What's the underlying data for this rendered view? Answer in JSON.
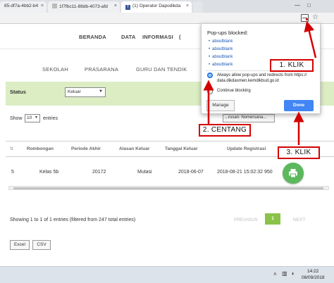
{
  "browser": {
    "tabs": [
      {
        "label": "85-df7a-4bb2-b4"
      },
      {
        "label": "1f7fbc11-88db-4073-afd"
      },
      {
        "label": "(1) Operator Dapodikda"
      }
    ],
    "window_controls": {
      "minimize": "—",
      "maximize": "□"
    },
    "toolbar_icons": [
      "popup-blocked-icon",
      "star-icon"
    ]
  },
  "nav": {
    "items": [
      {
        "label": "BERANDA"
      },
      {
        "label": "DATA"
      },
      {
        "label": "INFORMASI"
      },
      {
        "label": "("
      }
    ],
    "subnav": [
      {
        "label": "SEKOLAH"
      },
      {
        "label": "PRASARANA"
      },
      {
        "label": "GURU DAN TENDIK"
      }
    ]
  },
  "filter": {
    "status_label": "Status",
    "status_value": "Keluar",
    "caret": "▼"
  },
  "table_controls": {
    "show_label": "Show",
    "length_value": "10",
    "entries_label": "entries",
    "search_value": "...rusan: Nomersana..."
  },
  "table": {
    "headers": [
      "Rombongan",
      "Periode Akhir",
      "Alasan Keluar",
      "Tanggal Keluar",
      "Update Registrasi"
    ],
    "rows": [
      {
        "no": "5",
        "rombongan": "Kelas 5b",
        "periode": "20172",
        "alasan": "Mutasi",
        "tanggal": "2018-06-07",
        "update": "2018-08-21 15:02:32 950"
      }
    ]
  },
  "footer": {
    "showing": "Showing 1 to 1 of 1 entries (filtered from 247 total entries)",
    "prev": "PREVIOUS",
    "page": "1",
    "next": "NEXT",
    "export": [
      "Excel",
      "CSV"
    ]
  },
  "popup": {
    "title": "Pop-ups blocked:",
    "links": [
      "aboutblank",
      "aboutblank",
      "aboutblank",
      "aboutblank",
      "aboutblank"
    ],
    "allow_text": "Always allow pop-ups and redirects from https:// data.dikdasmen.kemdikbud.go.id",
    "block_text": "Continue blocking",
    "manage": "Manage",
    "done": "Done"
  },
  "annotations": {
    "step1": "1. KLIK",
    "step2": "2. CENTANG",
    "step3": "3. KLIK",
    "color": "#d40000"
  },
  "taskbar": {
    "time": "14:22",
    "date": "08/09/2018"
  },
  "colors": {
    "accent_green": "#8bc34a",
    "filter_bg": "#dcedc4",
    "print_button": "#5cb85c",
    "done_blue": "#4285f4"
  }
}
